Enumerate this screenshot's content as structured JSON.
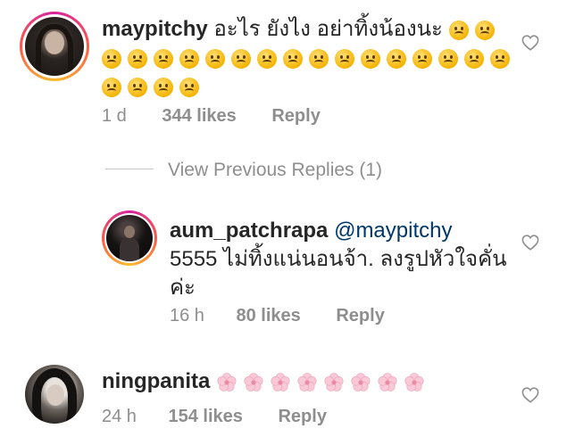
{
  "comments": [
    {
      "username": "maypitchy",
      "text": "อะไร ยังไง อย่าทิ้งน้องนะ",
      "emoji_icon": "worried-face-emoji",
      "emoji_count": 22,
      "time": "1 d",
      "likes": "344 likes",
      "reply_label": "Reply"
    },
    {
      "username": "aum_patchrapa",
      "mention": "@maypitchy",
      "text_line1": "5555 ไม่ทิ้งแน่นอนจ้า. ลงรูปหัวใจคั่น",
      "text_line2": "ค่ะ",
      "time": "16 h",
      "likes": "80 likes",
      "reply_label": "Reply"
    },
    {
      "username": "ningpanita",
      "emoji_icon": "cherry-blossom-emoji",
      "emoji_count": 8,
      "time": "24 h",
      "likes": "154 likes",
      "reply_label": "Reply"
    }
  ],
  "view_previous_replies": "View Previous Replies (1)",
  "colors": {
    "text": "#262626",
    "meta": "#8e8e8e",
    "mention": "#00376b",
    "story_ring_start": "#d6249f",
    "story_ring_end": "#fdbb2d"
  }
}
